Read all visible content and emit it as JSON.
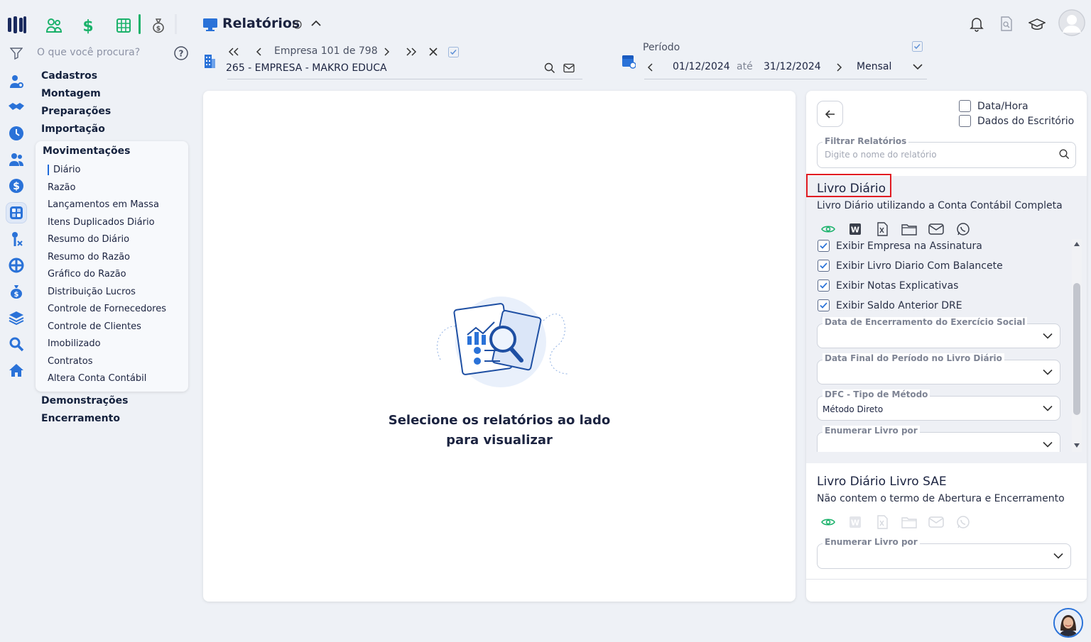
{
  "sidebar": {
    "search_placeholder": "O que você procura?",
    "menu": {
      "cadastros": "Cadastros",
      "montagem": "Montagem",
      "preparacoes": "Preparações",
      "importacao": "Importação",
      "movimentacoes": "Movimentações",
      "demonstracoes": "Demonstrações",
      "encerramento": "Encerramento"
    },
    "sub_items": [
      "Diário",
      "Razão",
      "Lançamentos em Massa",
      "Itens Duplicados Diário",
      "Resumo do Diário",
      "Resumo do Razão",
      "Gráfico do Razão",
      "Distribuição Lucros",
      "Controle de Fornecedores",
      "Controle de Clientes",
      "Imobilizado",
      "Contratos",
      "Altera Conta Contábil"
    ]
  },
  "header": {
    "title": "Relatórios",
    "empresa_nav": "Empresa 101 de 798",
    "empresa_name": "265 - EMPRESA - MAKRO EDUCA",
    "periodo_label": "Período",
    "date_start": "01/12/2024",
    "ate": "até",
    "date_end": "31/12/2024",
    "frequency": "Mensal"
  },
  "main": {
    "empty_line1": "Selecione os relatórios ao lado",
    "empty_line2": "para visualizar"
  },
  "right_panel": {
    "options": {
      "data_hora": "Data/Hora",
      "dados_escritorio": "Dados do Escritório"
    },
    "filter_label": "Filtrar Relatórios",
    "filter_placeholder": "Digite o nome do relatório",
    "report1": {
      "title": "Livro Diário",
      "subtitle": "Livro Diário utilizando a Conta Contábil Completa",
      "checks": [
        "Exibir Empresa na Assinatura",
        "Exibir Livro Diario Com Balancete",
        "Exibir Notas Explicativas",
        "Exibir Saldo Anterior DRE"
      ],
      "fields": {
        "encerramento": {
          "label": "Data de Encerramento do Exercício Social",
          "value": ""
        },
        "data_final": {
          "label": "Data Final do Período no Livro Diário",
          "value": ""
        },
        "dfc": {
          "label": "DFC - Tipo de Método",
          "value": "Método Direto"
        },
        "enumerar": {
          "label": "Enumerar Livro por",
          "value": ""
        }
      }
    },
    "report2": {
      "title": "Livro Diário Livro SAE",
      "subtitle": "Não contem o termo de Abertura e Encerramento",
      "enumerar_label": "Enumerar Livro por"
    }
  },
  "colors": {
    "accent": "#1e6ad9",
    "green": "#1bb26b",
    "highlight": "#e11b22"
  }
}
